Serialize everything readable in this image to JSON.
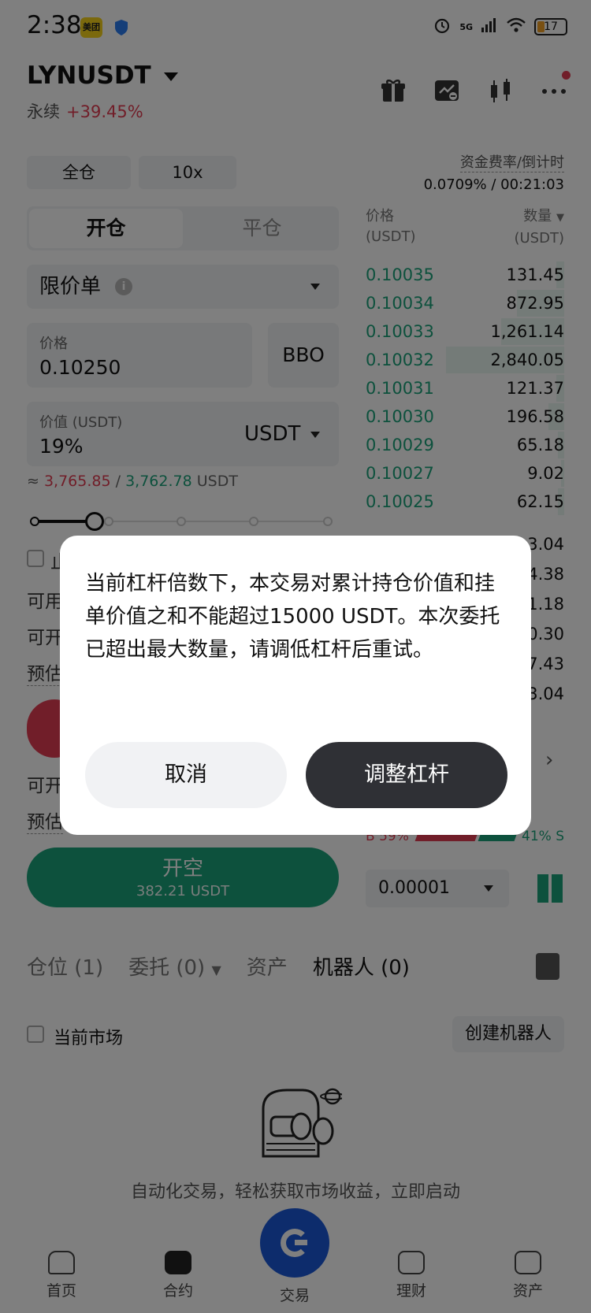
{
  "status": {
    "time": "2:38",
    "app_badge": "美团",
    "network": "5G",
    "battery": "17"
  },
  "pair": {
    "symbol": "LYNUSDT",
    "type": "永续",
    "change": "+39.45%"
  },
  "margin": {
    "mode": "全仓",
    "leverage": "10x"
  },
  "funding": {
    "label": "资金费率/倒计时",
    "value": "0.0709% / 00:21:03"
  },
  "order_form": {
    "tab_open": "开仓",
    "tab_close": "平仓",
    "order_type": "限价单",
    "info": "i",
    "price_label": "价格",
    "price_value": "0.10250",
    "bbo": "BBO",
    "value_label": "价值 (USDT)",
    "value_value": "19%",
    "unit_select": "USDT",
    "approx_prefix": "≈",
    "approx_red": "3,765.85",
    "approx_sep": "/",
    "approx_green": "3,762.78",
    "approx_unit": "USDT",
    "slider_percent": 25,
    "peek_1": "止",
    "peek_2": "可用",
    "peek_3": "可开",
    "peek_4": "预估",
    "peek_5": "可开",
    "peek_6": "预估",
    "open_short": "开空",
    "open_short_amount": "382.21 USDT"
  },
  "orderbook": {
    "price_header": "价格",
    "price_unit": "(USDT)",
    "qty_header": "数量",
    "qty_unit": "(USDT)",
    "rows": [
      {
        "price": "0.10035",
        "qty": "131.45"
      },
      {
        "price": "0.10034",
        "qty": "872.95"
      },
      {
        "price": "0.10033",
        "qty": "1,261.14"
      },
      {
        "price": "0.10032",
        "qty": "2,840.05"
      },
      {
        "price": "0.10031",
        "qty": "121.37"
      },
      {
        "price": "0.10030",
        "qty": "196.58"
      },
      {
        "price": "0.10029",
        "qty": "65.18"
      },
      {
        "price": "0.10027",
        "qty": "9.02"
      },
      {
        "price": "0.10025",
        "qty": "62.15"
      }
    ],
    "hidden_qty_tails": [
      "3.04",
      "4.38",
      "1.18",
      "0.30",
      "7.43",
      "3.04"
    ],
    "buy_ratio": "B 59%",
    "sell_ratio": "41% S",
    "precision": "0.00001"
  },
  "tabs": {
    "positions": "仓位 (1)",
    "orders": "委托 (0)",
    "assets": "资产",
    "bots": "机器人 (0)"
  },
  "bots_panel": {
    "current_market": "当前市场",
    "create_bot": "创建机器人",
    "slogan": "自动化交易，轻松获取市场收益，立即启动"
  },
  "nav": {
    "home": "首页",
    "futures": "合约",
    "trade": "交易",
    "finance": "理财",
    "assets": "资产"
  },
  "dialog": {
    "message": "当前杠杆倍数下，本交易对累计持仓价值和挂单价值之和不能超过15000 USDT。本次委托已超出最大数量，请调低杠杆后重试。",
    "cancel": "取消",
    "adjust": "调整杠杆"
  },
  "colors": {
    "up_green": "#1ba27a",
    "down_red": "#e23d52",
    "dark_button": "#2f3035",
    "brand_blue": "#1a59d9"
  }
}
